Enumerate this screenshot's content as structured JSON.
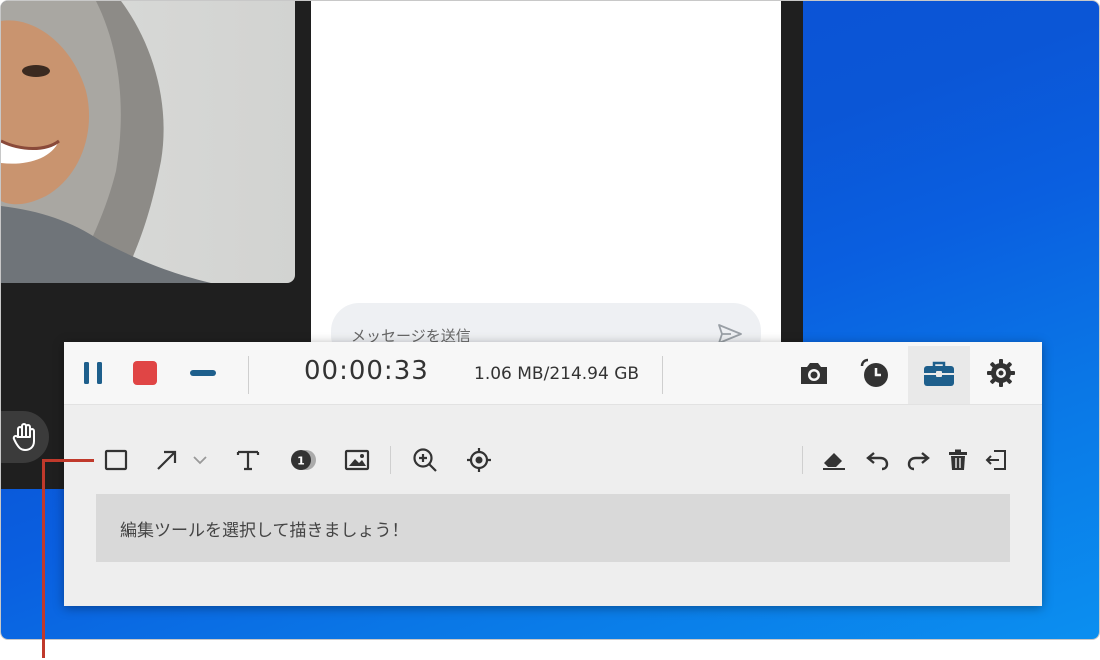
{
  "chat": {
    "placeholder": "メッセージを送信"
  },
  "recorder": {
    "timer": "00:00:33",
    "file_size": "1.06 MB/214.94 GB",
    "hint": "編集ツールを選択して描きましょう！",
    "icons": {
      "pause": "pause-icon",
      "stop": "stop-icon",
      "minimize": "minimize-icon",
      "screenshot": "camera-icon",
      "schedule": "alarm-clock-icon",
      "toolbox": "toolbox-icon",
      "settings": "gear-icon",
      "rectangle": "rectangle-icon",
      "arrow": "arrow-icon",
      "text": "text-icon",
      "number": "number-badge-icon",
      "image": "image-icon",
      "zoom": "zoom-in-icon",
      "spotlight": "target-icon",
      "eraser": "eraser-icon",
      "undo": "undo-icon",
      "redo": "redo-icon",
      "delete": "trash-icon",
      "exit": "exit-icon"
    },
    "colors": {
      "accent": "#1e5f8c",
      "stop": "#e04545",
      "callout": "#c0392b"
    }
  }
}
